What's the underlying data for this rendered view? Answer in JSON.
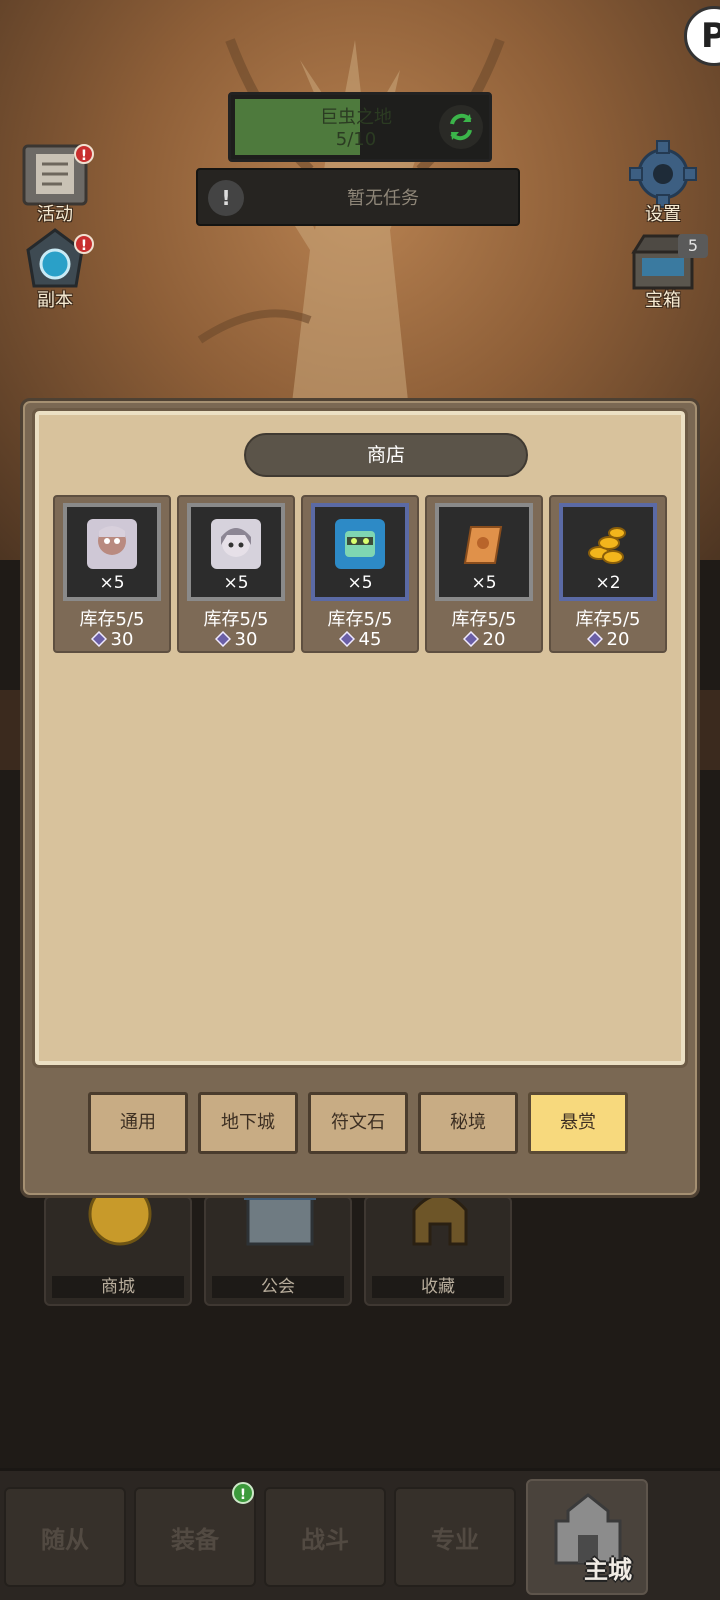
{
  "hud": {
    "zone_name": "巨虫之地",
    "zone_progress": "5/10",
    "zone_progress_value": 0.5,
    "task_text": "暂无任务",
    "task_icon": "!"
  },
  "side_buttons": {
    "activity": {
      "label": "活动",
      "alert": "!"
    },
    "dungeon": {
      "label": "副本",
      "alert": "!"
    },
    "settings": {
      "label": "设置"
    },
    "chest": {
      "label": "宝箱",
      "count": "5"
    }
  },
  "corner_button": {
    "glyph": "P"
  },
  "shop": {
    "title": "商店",
    "items": [
      {
        "icon": "hero-portrait-icon",
        "frame": "gray",
        "qty": "×5",
        "stock": "库存5/5",
        "price": "30"
      },
      {
        "icon": "hero-portrait-icon",
        "frame": "gray",
        "qty": "×5",
        "stock": "库存5/5",
        "price": "30"
      },
      {
        "icon": "robot-portrait-icon",
        "frame": "blue",
        "qty": "×5",
        "stock": "库存5/5",
        "price": "45"
      },
      {
        "icon": "scroll-icon",
        "frame": "gray",
        "qty": "×5",
        "stock": "库存5/5",
        "price": "20"
      },
      {
        "icon": "gold-coins-icon",
        "frame": "blue",
        "qty": "×2",
        "stock": "库存5/5",
        "price": "20"
      }
    ],
    "tabs": [
      {
        "label": "通用",
        "active": false
      },
      {
        "label": "地下城",
        "active": false
      },
      {
        "label": "符文石",
        "active": false
      },
      {
        "label": "秘境",
        "active": false
      },
      {
        "label": "悬赏",
        "active": true
      }
    ]
  },
  "buildings": [
    {
      "label": "商城",
      "icon": "coin-icon"
    },
    {
      "label": "公会",
      "icon": "guild-hall-icon"
    },
    {
      "label": "收藏",
      "icon": "helmet-icon"
    }
  ],
  "bottom_nav": {
    "items": [
      "随从",
      "装备",
      "战斗",
      "专业"
    ],
    "active_label": "主城",
    "equipment_alert": "!"
  },
  "colors": {
    "panel_bg": "#d8c29c",
    "tab_active": "#f7d97d",
    "alert_red": "#c82e2e",
    "alert_green": "#3c9a3c",
    "zone_green": "#4e7a3d"
  }
}
